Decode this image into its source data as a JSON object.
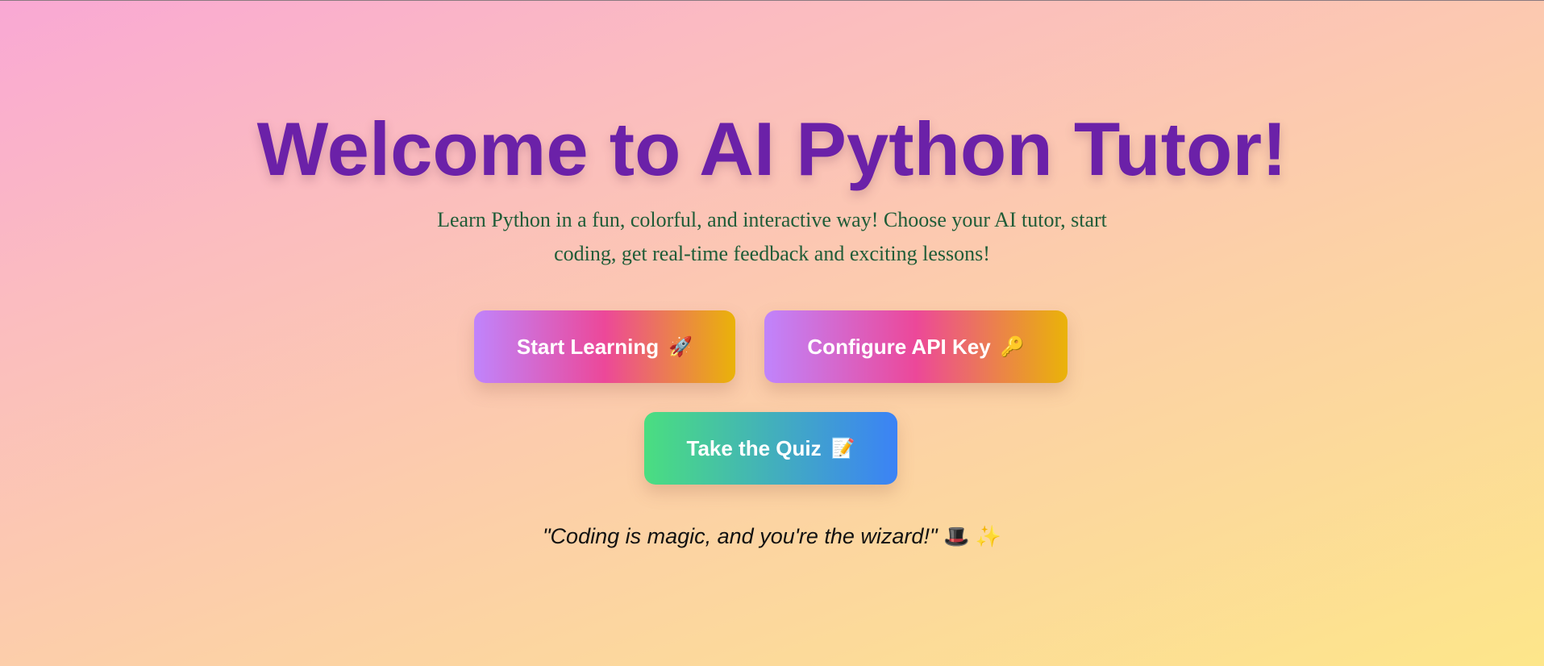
{
  "hero": {
    "title": "Welcome to AI Python Tutor!",
    "subtitle": "Learn Python in a fun, colorful, and interactive way! Choose your AI tutor, start coding, get real-time feedback and exciting lessons!"
  },
  "actions": {
    "start_label": "Start Learning",
    "start_icon": "🚀",
    "start_icon_name": "rocket-icon",
    "api_label": "Configure API Key",
    "api_icon": "🔑",
    "api_icon_name": "key-icon",
    "quiz_label": "Take the Quiz",
    "quiz_icon": "📝",
    "quiz_icon_name": "memo-icon"
  },
  "quote": {
    "text": "\"Coding is magic, and you're the wizard!\"",
    "icons": "🎩 ✨",
    "icon_names": [
      "top-hat-icon",
      "sparkles-icon"
    ]
  },
  "colors": {
    "title": "#6b21a8",
    "subtitle": "#1f5c37",
    "warm_gradient": [
      "#c084fc",
      "#ec4899",
      "#eab308"
    ],
    "cool_gradient": [
      "#4ade80",
      "#3b82f6"
    ],
    "background_gradient": [
      "#f9a8d4",
      "#fcd1a6",
      "#fde68a"
    ]
  }
}
